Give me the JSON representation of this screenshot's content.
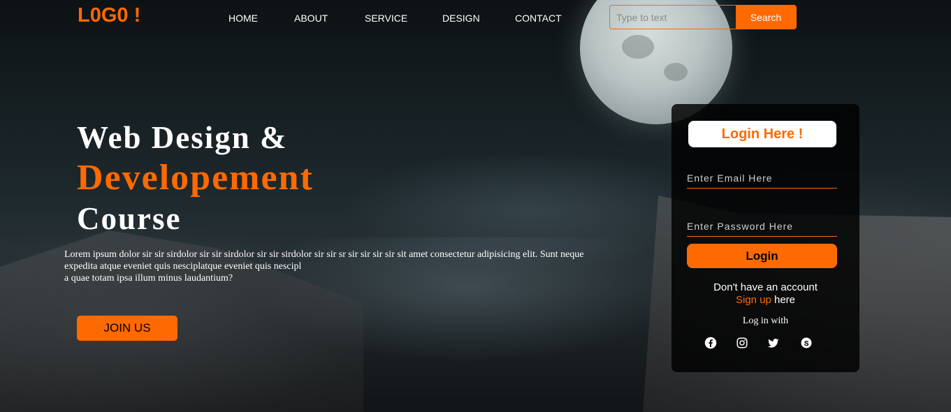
{
  "brand": {
    "logo": "L0G0 !"
  },
  "nav": {
    "items": [
      {
        "label": "HOME"
      },
      {
        "label": "ABOUT"
      },
      {
        "label": "SERVICE"
      },
      {
        "label": "DESIGN"
      },
      {
        "label": "CONTACT"
      }
    ]
  },
  "search": {
    "placeholder": "Type to text",
    "button": "Search"
  },
  "hero": {
    "line1": "Web Design &",
    "line2": "Developement",
    "line3": "Course",
    "paragraph_line1": "Lorem ipsum dolor sir sir sirdolor sir sir sirdolor sir sir sirdolor sir sir sr sir sir sir sir sit amet consectetur adipisicing elit. Sunt neque",
    "paragraph_line2": "expedita atque eveniet quis nesciplatque eveniet quis nescipl",
    "paragraph_line3": "a quae totam ipsa illum minus laudantium?",
    "join_button": "JOIN US"
  },
  "login": {
    "title": "Login Here !",
    "email_placeholder": "Enter Email Here",
    "password_placeholder": "Enter Password Here",
    "button": "Login",
    "no_account": "Don't have an account",
    "signup_link": "Sign up",
    "signup_suffix": " here",
    "log_in_with": "Log in with",
    "social_icons": [
      "facebook-icon",
      "instagram-icon",
      "twitter-icon",
      "skype-icon"
    ]
  },
  "colors": {
    "accent": "#ff6a00",
    "card_bg": "#000000",
    "text": "#ffffff"
  }
}
